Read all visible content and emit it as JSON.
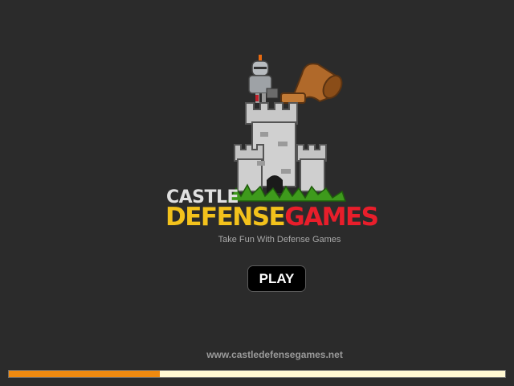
{
  "brand": {
    "line1": "CASTLE",
    "line2_part1": "DEFENSE",
    "line2_part2": "GAMES",
    "tagline": "Take Fun With Defense Games"
  },
  "play_button": {
    "label": "PLAY"
  },
  "footer": {
    "url": "www.castledefensegames.net"
  },
  "loading": {
    "progress_fraction": 0.305
  },
  "colors": {
    "background": "#2b2b2b",
    "defense_yellow": "#f3c21c",
    "games_red": "#e81e2b",
    "progress_fill": "#f08a10",
    "progress_track": "#fff8d2"
  },
  "icons": [
    "knight-icon",
    "cannon-icon",
    "castle-tower-icon",
    "grass-icon"
  ]
}
